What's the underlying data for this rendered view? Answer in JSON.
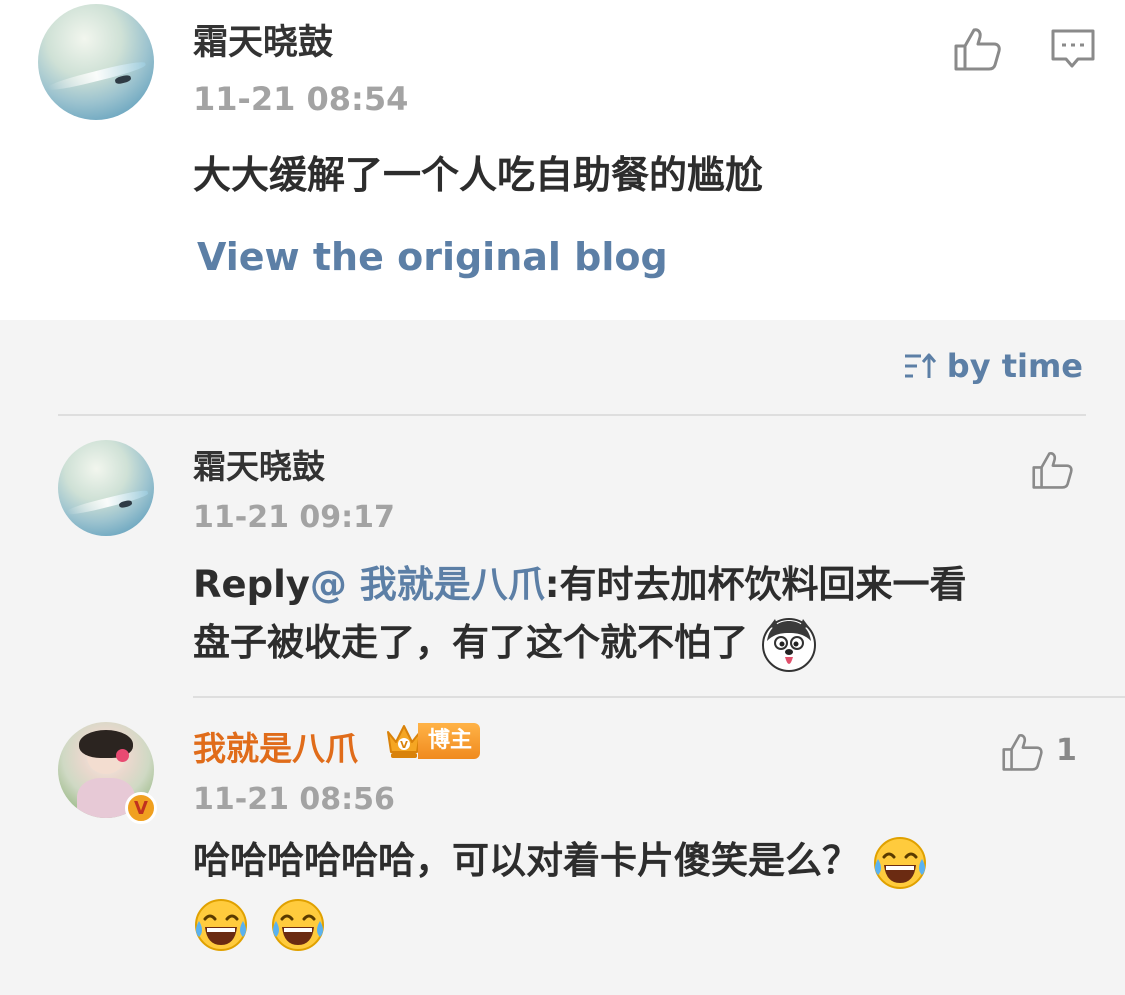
{
  "original": {
    "name": "霜天晓鼓",
    "time": "11-21 08:54",
    "text": "大大缓解了一个人吃自助餐的尴尬",
    "view_link": "View the original blog"
  },
  "sort": {
    "label": "by time",
    "icon": "sort-icon"
  },
  "replies": [
    {
      "name": "霜天晓鼓",
      "time": "11-21 09:17",
      "prefix": "Reply",
      "mention": "@ 我就是八爪",
      "text_line1": ":有时去加杯饮料回来一看",
      "text_line2": "盘子被收走了，有了这个就不怕了",
      "emoji": "husky-emoji"
    },
    {
      "name": "我就是八爪",
      "badge": "博主",
      "time": "11-21 08:56",
      "like_count": "1",
      "text_line1": "哈哈哈哈哈哈，可以对着卡片傻笑是么？",
      "emoji": "laugh-cry-emoji",
      "verified": "V"
    }
  ],
  "colors": {
    "link": "#5c7fa6",
    "name_orange": "#e06c1a",
    "background": "#f4f4f4"
  }
}
